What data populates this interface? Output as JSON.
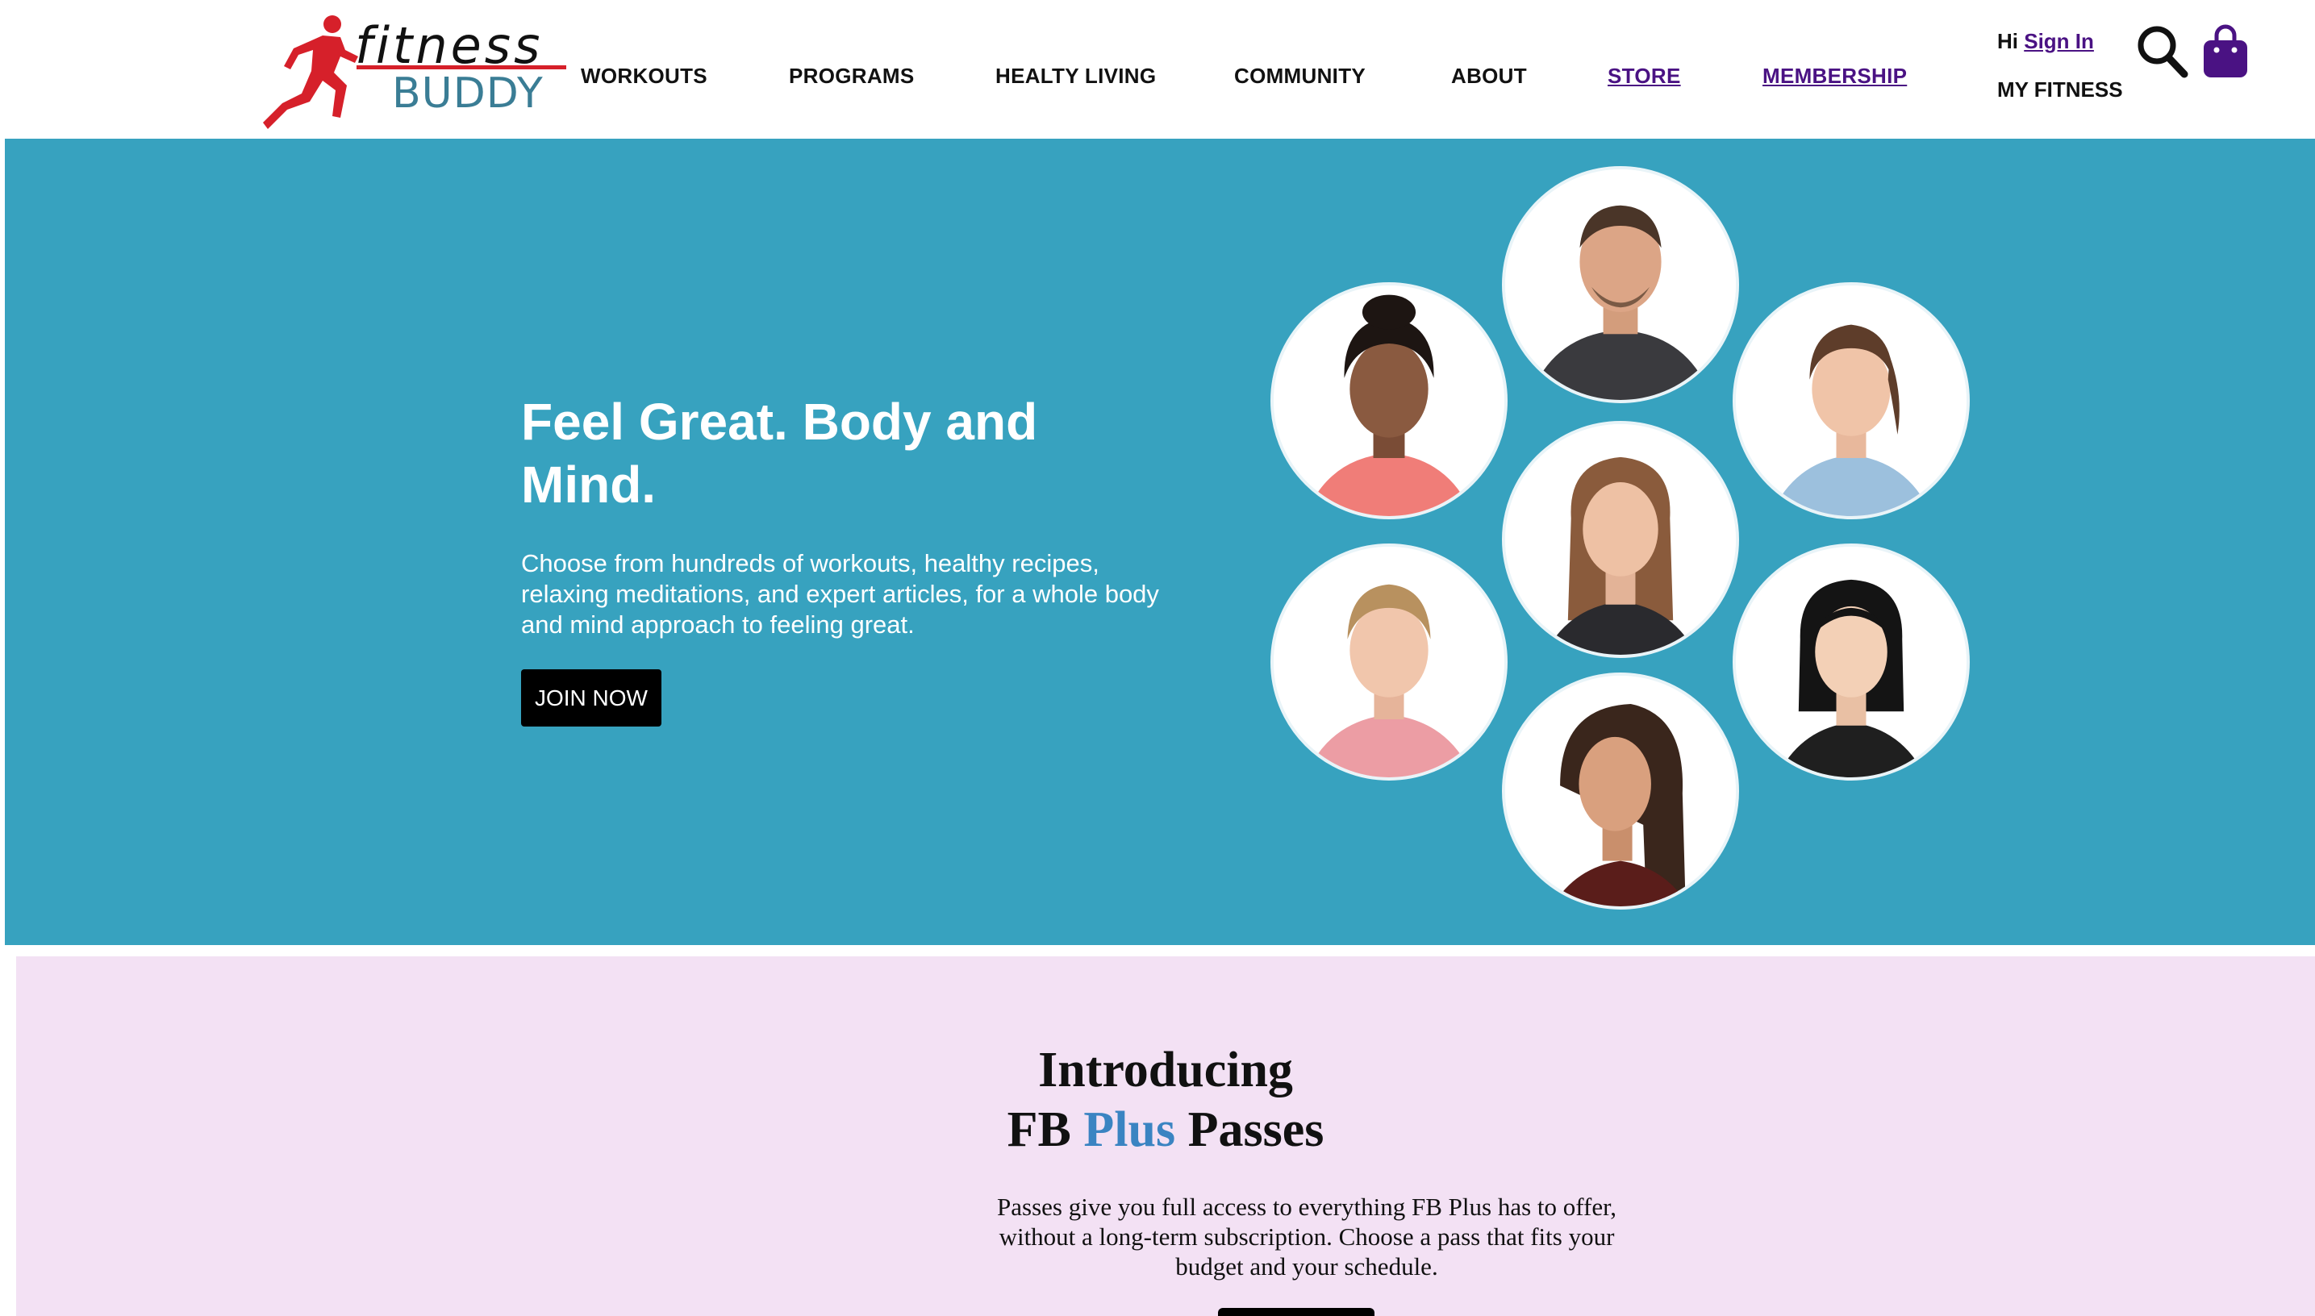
{
  "brand": {
    "name_top": "fitness",
    "name_bottom": "BUDDY",
    "colors": {
      "runner": "#d6202a",
      "buddy": "#3a7d95"
    }
  },
  "nav": {
    "items": [
      {
        "label": "WORKOUTS"
      },
      {
        "label": "PROGRAMS"
      },
      {
        "label": "HEALTY LIVING"
      },
      {
        "label": "COMMUNITY"
      },
      {
        "label": "ABOUT"
      },
      {
        "label": "STORE"
      },
      {
        "label": "MEMBERSHIP"
      }
    ],
    "link_color": "#4a1283"
  },
  "account": {
    "greeting": "Hi",
    "sign_in": "Sign In",
    "my_fitness": "MY FITNESS"
  },
  "icons": {
    "search": "search-icon",
    "bag": "shopping-bag-icon",
    "bag_color": "#4a1283"
  },
  "hero": {
    "background": "#37a2bf",
    "title": "Feel Great. Body and Mind.",
    "subtitle": "Choose from hundreds of workouts, healthy recipes, relaxing meditations, and expert articles, for a whole body and mind approach to feeling great.",
    "cta": "JOIN NOW",
    "instructors_count": 7
  },
  "passes": {
    "background": "#f3e1f4",
    "title_line1": "Introducing",
    "title_fb": "FB",
    "title_plus": "Plus",
    "title_passes": "Passes",
    "plus_color": "#3a84c2",
    "body": "Passes give you full access to everything FB Plus has to offer, without a long-term subscription. Choose a pass that fits your budget and your schedule."
  }
}
